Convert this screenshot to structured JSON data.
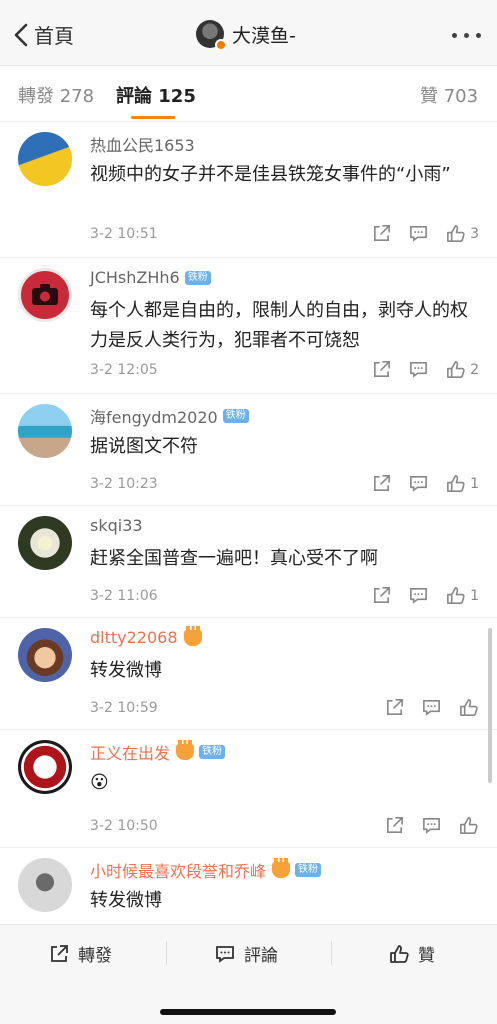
{
  "header": {
    "back_label": "首頁",
    "title": "大漠鱼-",
    "colors": {
      "accent": "#ff8200",
      "verified_badge": "#f57c00"
    }
  },
  "tabs": [
    {
      "label": "轉發",
      "count": "278",
      "active": false
    },
    {
      "label": "評論",
      "count": "125",
      "active": true
    },
    {
      "label": "贊",
      "count": "703",
      "active": false
    }
  ],
  "comments": [
    {
      "user": "热血公民1653",
      "tag": "",
      "vip": false,
      "text": "视频中的女子并不是佳县铁笼女事件的“小雨”",
      "time": "3-2 10:51",
      "likes": "3",
      "avatar_icon": "flag-avatar"
    },
    {
      "user": "JCHshZHh6",
      "tag": "铁粉",
      "vip": false,
      "text": "每个人都是自由的，限制人的自由，剥夺人的权力是反人类行为，犯罪者不可饶恕",
      "time": "3-2 12:05",
      "likes": "2",
      "avatar_icon": "camera-avatar"
    },
    {
      "user": "海fengydm2020",
      "tag": "铁粉",
      "vip": false,
      "text": "据说图文不符",
      "time": "3-2 10:23",
      "likes": "1",
      "avatar_icon": "seaside-avatar"
    },
    {
      "user": "skqi33",
      "tag": "",
      "vip": false,
      "text": "赶紧全国普查一遍吧！真心受不了啊",
      "time": "3-2 11:06",
      "likes": "1",
      "avatar_icon": "flower-avatar"
    },
    {
      "user": "dltty22068",
      "tag": "",
      "vip": true,
      "text": "转发微博",
      "time": "3-2 10:59",
      "likes": "",
      "avatar_icon": "cartoon-avatar"
    },
    {
      "user": "正义在出发",
      "tag": "铁粉",
      "vip": true,
      "text": "😮",
      "time": "3-2 10:50",
      "likes": "",
      "avatar_icon": "logo-avatar"
    },
    {
      "user": "小时候最喜欢段誉和乔峰",
      "tag": "铁粉",
      "vip": true,
      "text": "转发微博",
      "time": "",
      "likes": "",
      "avatar_icon": "photo-avatar"
    }
  ],
  "bottom": {
    "repost_label": "轉發",
    "comment_label": "評論",
    "like_label": "贊"
  }
}
